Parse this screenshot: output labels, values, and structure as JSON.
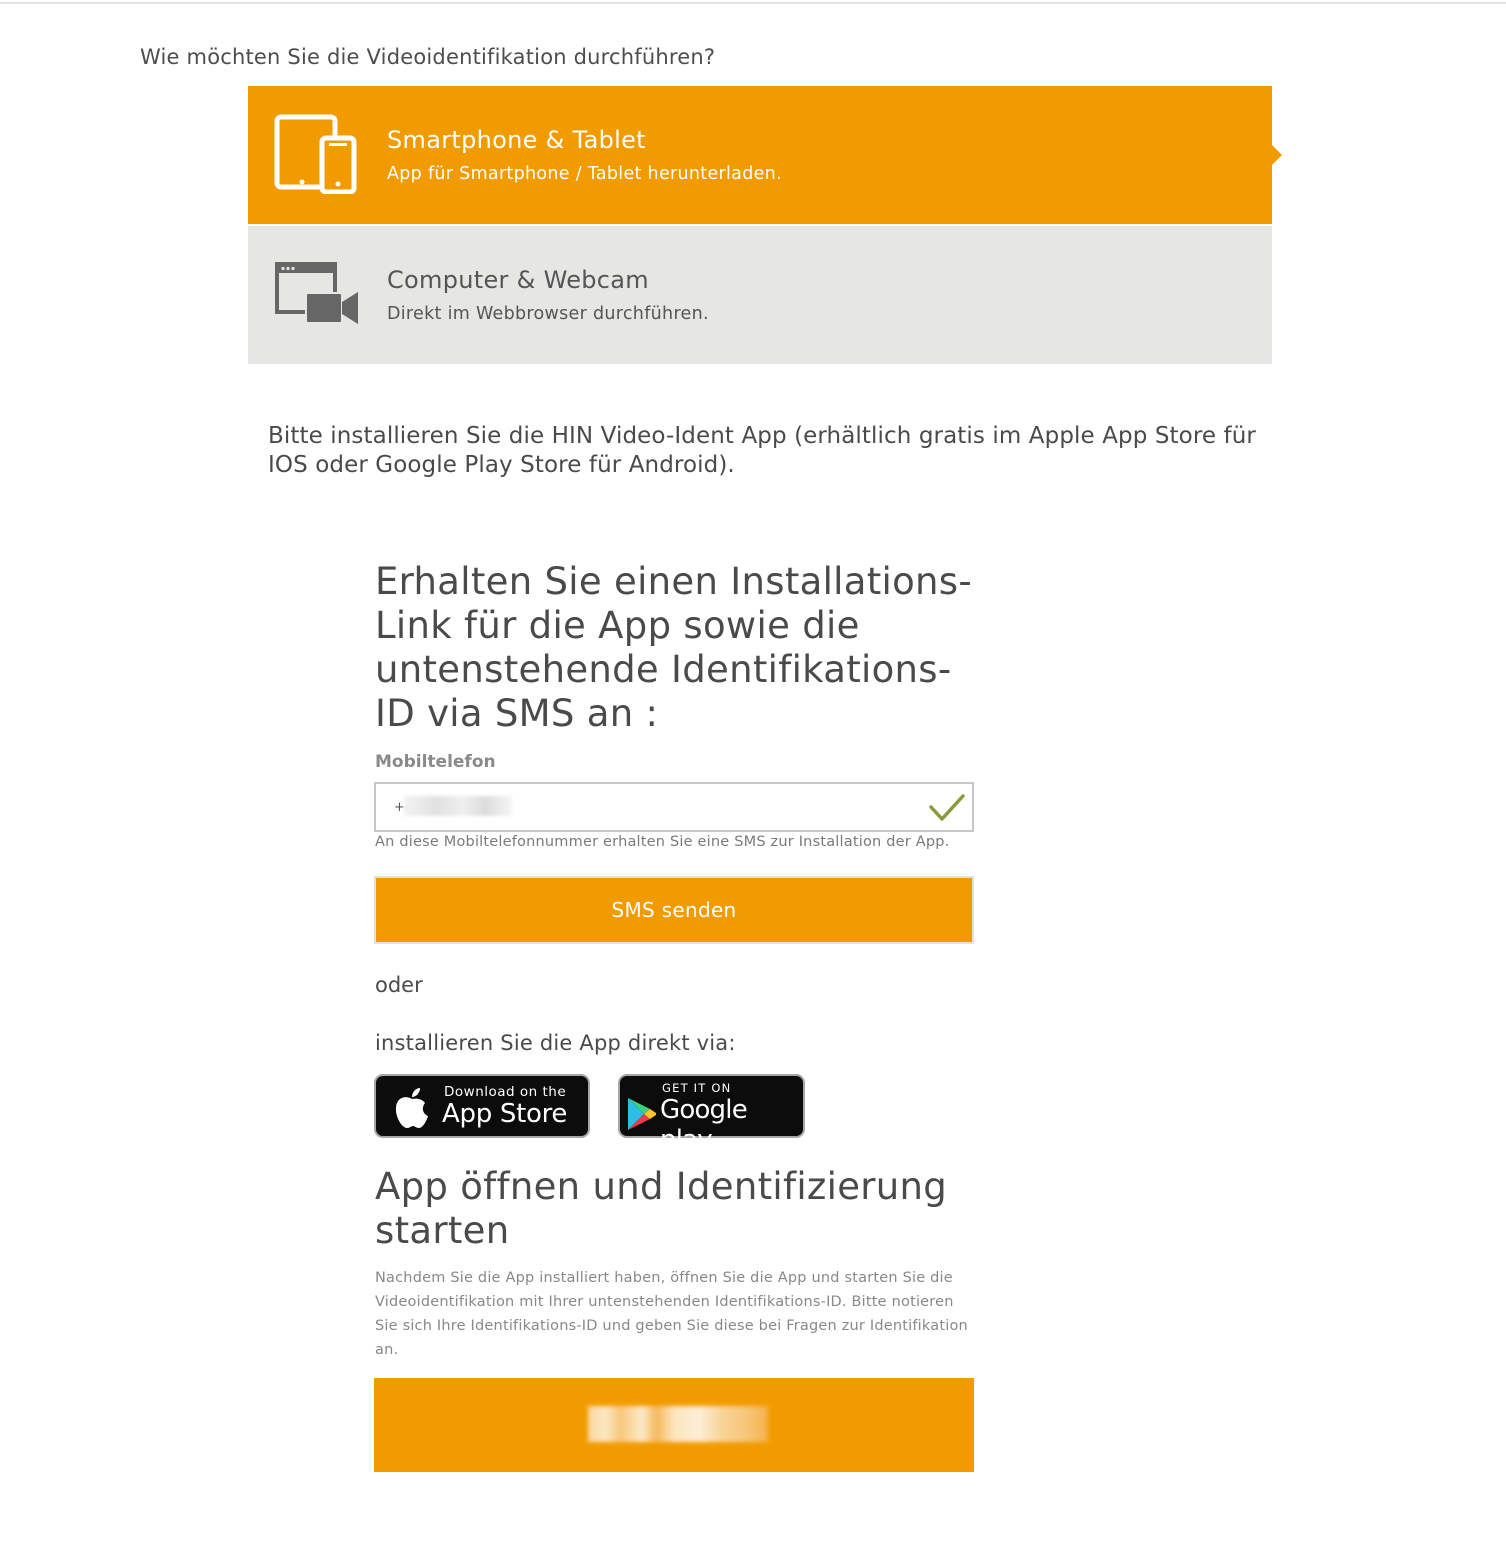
{
  "question": "Wie möchten Sie die Videoidentifikation durchführen?",
  "options": [
    {
      "title": "Smartphone & Tablet",
      "subtitle": "App für Smartphone / Tablet herunterladen.",
      "icon": "smartphone-tablet-icon",
      "selected": true
    },
    {
      "title": "Computer & Webcam",
      "subtitle": "Direkt im Webbrowser durchführen.",
      "icon": "computer-webcam-icon",
      "selected": false
    }
  ],
  "install_note": "Bitte installieren Sie die HIN Video-Ident App (erhältlich gratis im Apple App Store für IOS oder Google Play Store für Android).",
  "sms": {
    "heading": "Erhalten Sie einen Installations-Link für die App sowie die untenstehende Identifikations-ID via SMS an :",
    "field_label": "Mobiltelefon",
    "phone_value": "+4",
    "help_text": "An diese Mobiltelefonnummer erhalten Sie eine SMS zur Installation der App.",
    "button_label": "SMS senden"
  },
  "or_text": "oder",
  "direct_text": "installieren Sie die App direkt via:",
  "app_store": {
    "small": "Download on the",
    "big": "App Store"
  },
  "google_play": {
    "small": "GET IT ON",
    "big": "Google play"
  },
  "open": {
    "heading": "App öffnen und Identifizierung starten",
    "text": "Nachdem Sie die App installiert haben, öffnen Sie die App und starten Sie die Videoidentifikation mit Ihrer untenstehenden Identifikations-ID. Bitte notieren Sie sich Ihre Identifikations-ID und geben Sie diese bei Fragen zur Identifikation an."
  },
  "colors": {
    "accent": "#f29b00",
    "inactive_bg": "#e6e6e4",
    "text": "#4a4a4a",
    "check": "#8a9a3a"
  }
}
